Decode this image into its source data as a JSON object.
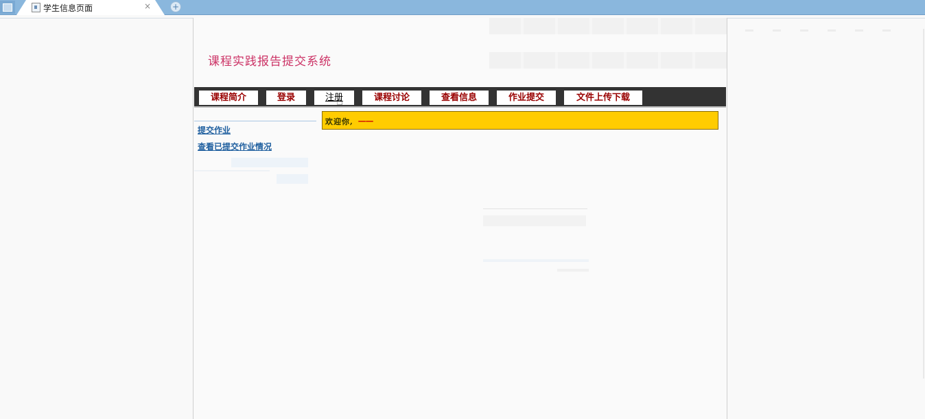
{
  "browser": {
    "tab_title": "学生信息页面",
    "tab_close": "×",
    "new_tab": "+"
  },
  "site": {
    "title": "课程实践报告提交系统"
  },
  "nav": {
    "items": [
      {
        "label": "课程简介"
      },
      {
        "label": "登录"
      },
      {
        "label": "注册"
      },
      {
        "label": "课程讨论"
      },
      {
        "label": "查看信息"
      },
      {
        "label": "作业提交"
      },
      {
        "label": "文件上传下载"
      }
    ],
    "hovered_index": 2
  },
  "sidebar": {
    "links": [
      {
        "label": "提交作业"
      },
      {
        "label": "查看已提交作业情况"
      }
    ]
  },
  "welcome": {
    "label": "欢迎你,",
    "user": "一一"
  },
  "colors": {
    "title": "#cc3366",
    "nav_bg": "#333333",
    "nav_text": "#990000",
    "welcome_bg": "#ffcc00",
    "welcome_user": "#cc0000",
    "link": "#1f5f9f",
    "tabbar": "#8ab7dd"
  }
}
